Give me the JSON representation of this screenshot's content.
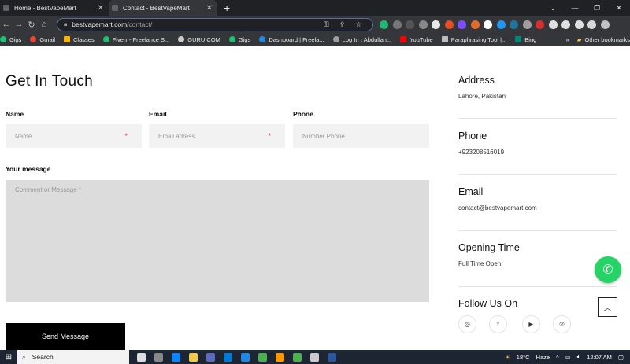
{
  "browser": {
    "tabs": [
      {
        "title": "Home - BestVapeMart",
        "active": false
      },
      {
        "title": "Contact - BestVapeMart",
        "active": true
      }
    ],
    "url_host": "bestvapemart.com",
    "url_path": "/contact/",
    "bookmarks": [
      "Gigs",
      "Gmail",
      "Classes",
      "Fiverr - Freelance S...",
      "GURU.COM",
      "Gigs",
      "Dashboard | Freela...",
      "Log In ‹ Abdullah...",
      "YouTube",
      "Paraphrasing Tool |...",
      "Bing"
    ],
    "bookmarks_more": "Other bookmarks"
  },
  "form": {
    "heading": "Get In Touch",
    "name_label": "Name",
    "name_placeholder": "Name",
    "email_label": "Email",
    "email_placeholder": "Email adress",
    "phone_label": "Phone",
    "phone_placeholder": "Number Phone",
    "message_label": "Your message",
    "message_placeholder": "Comment or Message *",
    "required_mark": "*",
    "submit_label": "Send Message"
  },
  "info": {
    "address_title": "Address",
    "address_value": "Lahore, Pakistan",
    "phone_title": "Phone",
    "phone_value": "+923208516019",
    "email_title": "Email",
    "email_value": "contact@bestvapemart.com",
    "hours_title": "Opening Time",
    "hours_value": "Full Time Open",
    "follow_title": "Follow Us On",
    "socials": [
      "instagram-icon",
      "facebook-icon",
      "youtube-icon",
      "pinterest-icon"
    ]
  },
  "taskbar": {
    "search_label": "Search",
    "weather": "18°C",
    "weather_desc": "Haze",
    "time": "12:07 AM"
  },
  "colors": {
    "whatsapp": "#25d366",
    "button_bg": "#000000",
    "field_bg": "#f2f2f2",
    "message_bg": "#dcdcdc"
  }
}
